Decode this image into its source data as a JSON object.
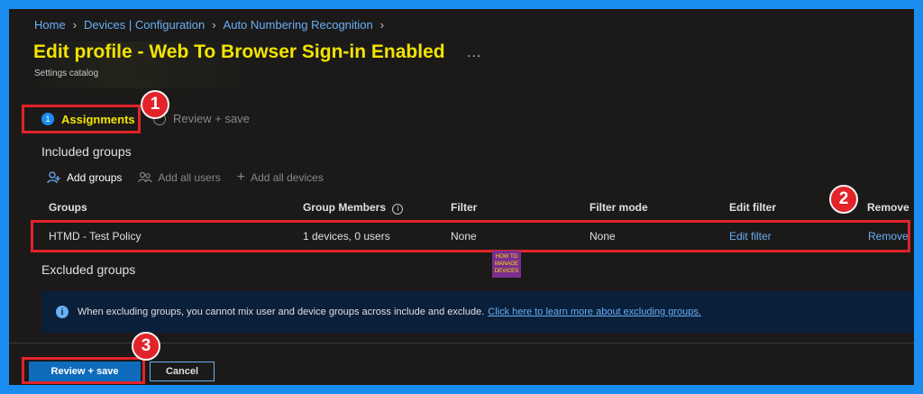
{
  "breadcrumb": [
    "Home",
    "Devices | Configuration",
    "Auto Numbering Recognition"
  ],
  "page": {
    "title": "Edit profile - Web To Browser Sign-in Enabled",
    "more": "...",
    "subtitle": "Settings catalog"
  },
  "steps": {
    "assignments": {
      "number": "1",
      "label": "Assignments"
    },
    "review": {
      "label": "Review + save"
    }
  },
  "annotations": [
    "1",
    "2",
    "3"
  ],
  "included": {
    "title": "Included groups",
    "toolbar": {
      "add_groups": "Add groups",
      "add_all_users": "Add all users",
      "add_all_devices": "Add all devices"
    },
    "columns": [
      "Groups",
      "Group Members",
      "Filter",
      "Filter mode",
      "Edit filter",
      "Remove"
    ],
    "rows": [
      {
        "group": "HTMD - Test Policy",
        "members": "1 devices, 0 users",
        "filter": "None",
        "filter_mode": "None",
        "edit_filter": "Edit filter",
        "remove": "Remove"
      }
    ]
  },
  "excluded": {
    "title": "Excluded groups",
    "info": "When excluding groups, you cannot mix user and device groups across include and exclude.",
    "info_link": "Click here to learn more about excluding groups."
  },
  "footer": {
    "review_button": "Review + save",
    "cancel_button": "Cancel"
  },
  "colors": {
    "frame": "#1b8df0",
    "background": "#1b1a19",
    "title": "#f3e300",
    "annotation": "#e2232a",
    "link": "#69aff5",
    "primary": "#0f6cbd"
  }
}
